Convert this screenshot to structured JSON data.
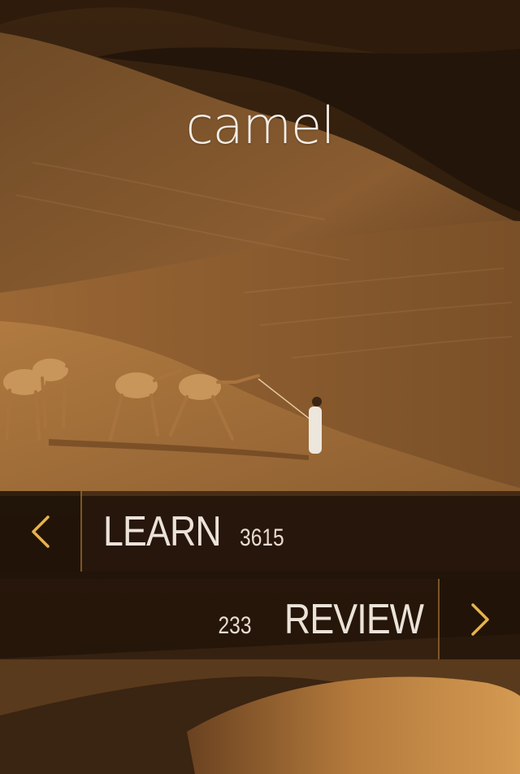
{
  "card": {
    "word": "camel"
  },
  "learn": {
    "label": "LEARN",
    "count": "3615"
  },
  "review": {
    "label": "REVIEW",
    "count": "233"
  },
  "icons": {
    "prev": "chevron-left-icon",
    "next": "chevron-right-icon"
  },
  "colors": {
    "accent": "#e8b34a",
    "bar_bg": "#28180c",
    "text": "#ece3d8"
  },
  "background": {
    "image": "desert-camel-caravan-photo"
  }
}
